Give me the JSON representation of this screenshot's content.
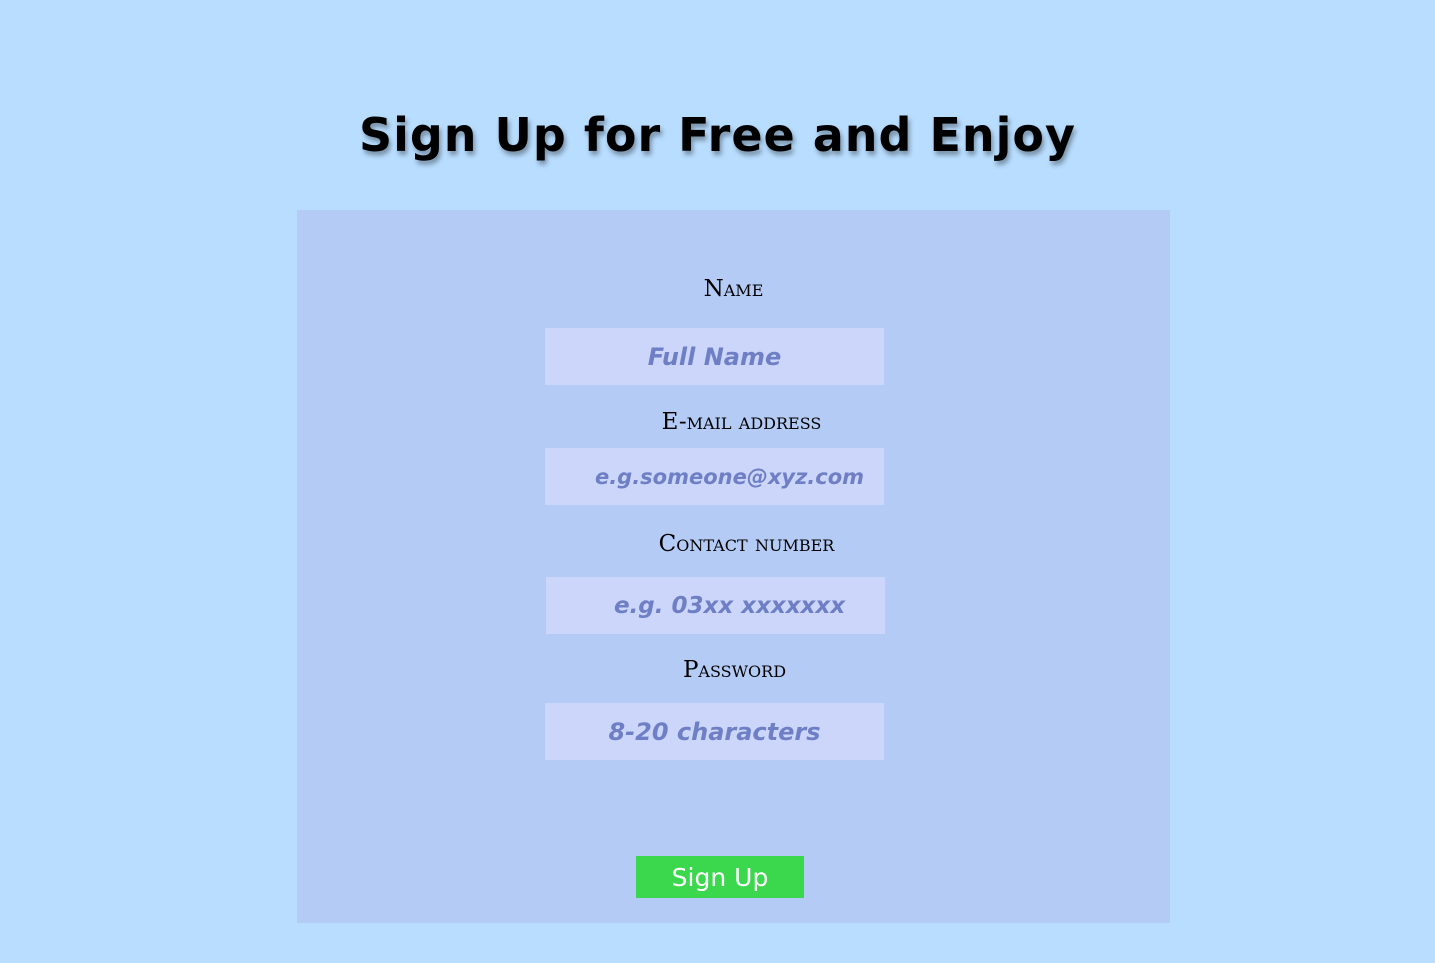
{
  "page": {
    "title": "Sign Up for Free and Enjoy"
  },
  "form": {
    "fields": [
      {
        "label": "Name",
        "placeholder": "Full Name",
        "value": ""
      },
      {
        "label": "E-mail address",
        "placeholder": "e.g.someone@xyz.com",
        "value": ""
      },
      {
        "label": "Contact number",
        "placeholder": "e.g. 03xx xxxxxxx",
        "value": ""
      },
      {
        "label": "Password",
        "placeholder": "8-20 characters",
        "value": ""
      }
    ],
    "submit_label": "Sign Up"
  },
  "colors": {
    "page_background": "#b8ddff",
    "card_background": "#b4cbf5",
    "input_background": "#cbd6fa",
    "placeholder_text": "#6f7fc6",
    "button_background": "#3bd84d"
  }
}
